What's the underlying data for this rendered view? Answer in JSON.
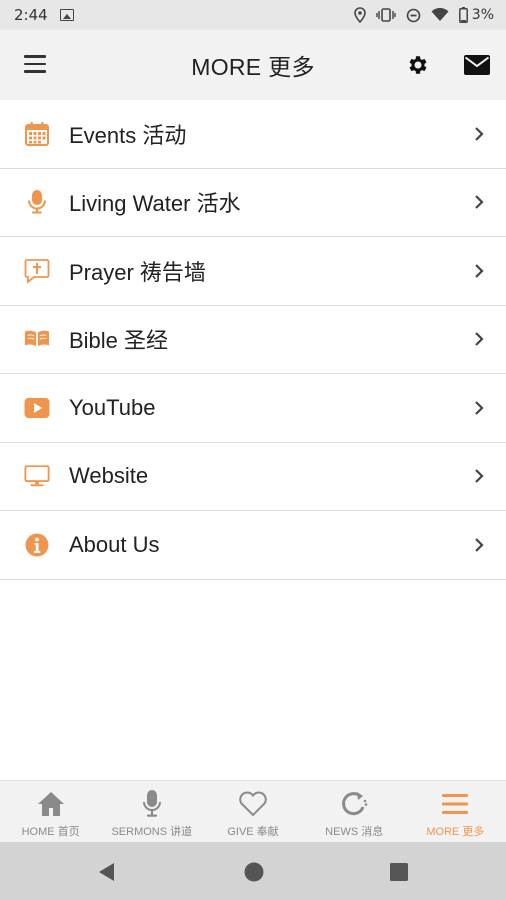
{
  "status_bar": {
    "time": "2:44",
    "battery": "3%",
    "icons": [
      "gallery-icon",
      "location-icon",
      "vibrate-icon",
      "dnd-icon",
      "wifi-icon",
      "battery-icon"
    ]
  },
  "header": {
    "title": "MORE 更多",
    "icons": [
      "menu-icon",
      "gear-icon",
      "mail-icon"
    ]
  },
  "menu": {
    "items": [
      {
        "label": "Events 活动",
        "icon": "calendar-icon"
      },
      {
        "label": "Living Water 活水",
        "icon": "microphone-icon"
      },
      {
        "label": "Prayer 祷告墙",
        "icon": "prayer-bubble-icon"
      },
      {
        "label": "Bible 圣经",
        "icon": "book-icon"
      },
      {
        "label": "YouTube",
        "icon": "youtube-icon"
      },
      {
        "label": "Website",
        "icon": "monitor-icon"
      },
      {
        "label": "About Us",
        "icon": "info-icon"
      }
    ]
  },
  "tabs": [
    {
      "label": "HOME 首页",
      "icon": "home-icon",
      "active": false
    },
    {
      "label": "SERMONS 讲道",
      "icon": "microphone-icon",
      "active": false
    },
    {
      "label": "GIVE 奉献",
      "icon": "heart-icon",
      "active": false
    },
    {
      "label": "NEWS 消息",
      "icon": "refresh-icon",
      "active": false
    },
    {
      "label": "MORE 更多",
      "icon": "menu-icon",
      "active": true
    }
  ],
  "colors": {
    "accent": "#f0954d",
    "tab_inactive": "#8a8a8a",
    "header_bg": "#f2f2f2"
  }
}
